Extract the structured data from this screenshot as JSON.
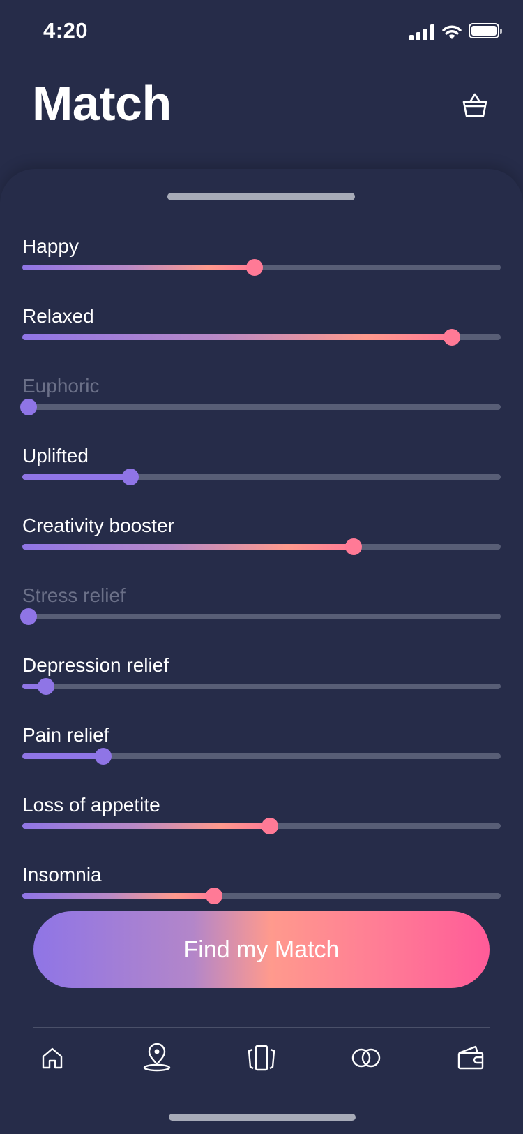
{
  "status_bar": {
    "time": "4:20"
  },
  "header": {
    "title": "Match"
  },
  "sliders": [
    {
      "label": "Happy",
      "value": 0.486,
      "enabled": true
    },
    {
      "label": "Relaxed",
      "value": 0.898,
      "enabled": true
    },
    {
      "label": "Euphoric",
      "value": 0.012,
      "enabled": false
    },
    {
      "label": "Uplifted",
      "value": 0.226,
      "enabled": true
    },
    {
      "label": "Creativity booster",
      "value": 0.693,
      "enabled": true
    },
    {
      "label": "Stress relief",
      "value": 0.012,
      "enabled": false
    },
    {
      "label": "Depression relief",
      "value": 0.05,
      "enabled": true
    },
    {
      "label": "Pain relief",
      "value": 0.169,
      "enabled": true
    },
    {
      "label": "Loss of appetite",
      "value": 0.518,
      "enabled": true
    },
    {
      "label": "Insomnia",
      "value": 0.401,
      "enabled": true
    }
  ],
  "cta": {
    "label": "Find my Match"
  },
  "tab_bar": {
    "items": [
      "home-icon",
      "location-pin-icon",
      "cards-icon",
      "match-icon",
      "wallet-icon"
    ]
  },
  "colors": {
    "background": "#262c49",
    "track": "#585e76",
    "purple": "#8f75e6",
    "pink": "#ff7a96",
    "disabled_text": "#6b7088"
  }
}
